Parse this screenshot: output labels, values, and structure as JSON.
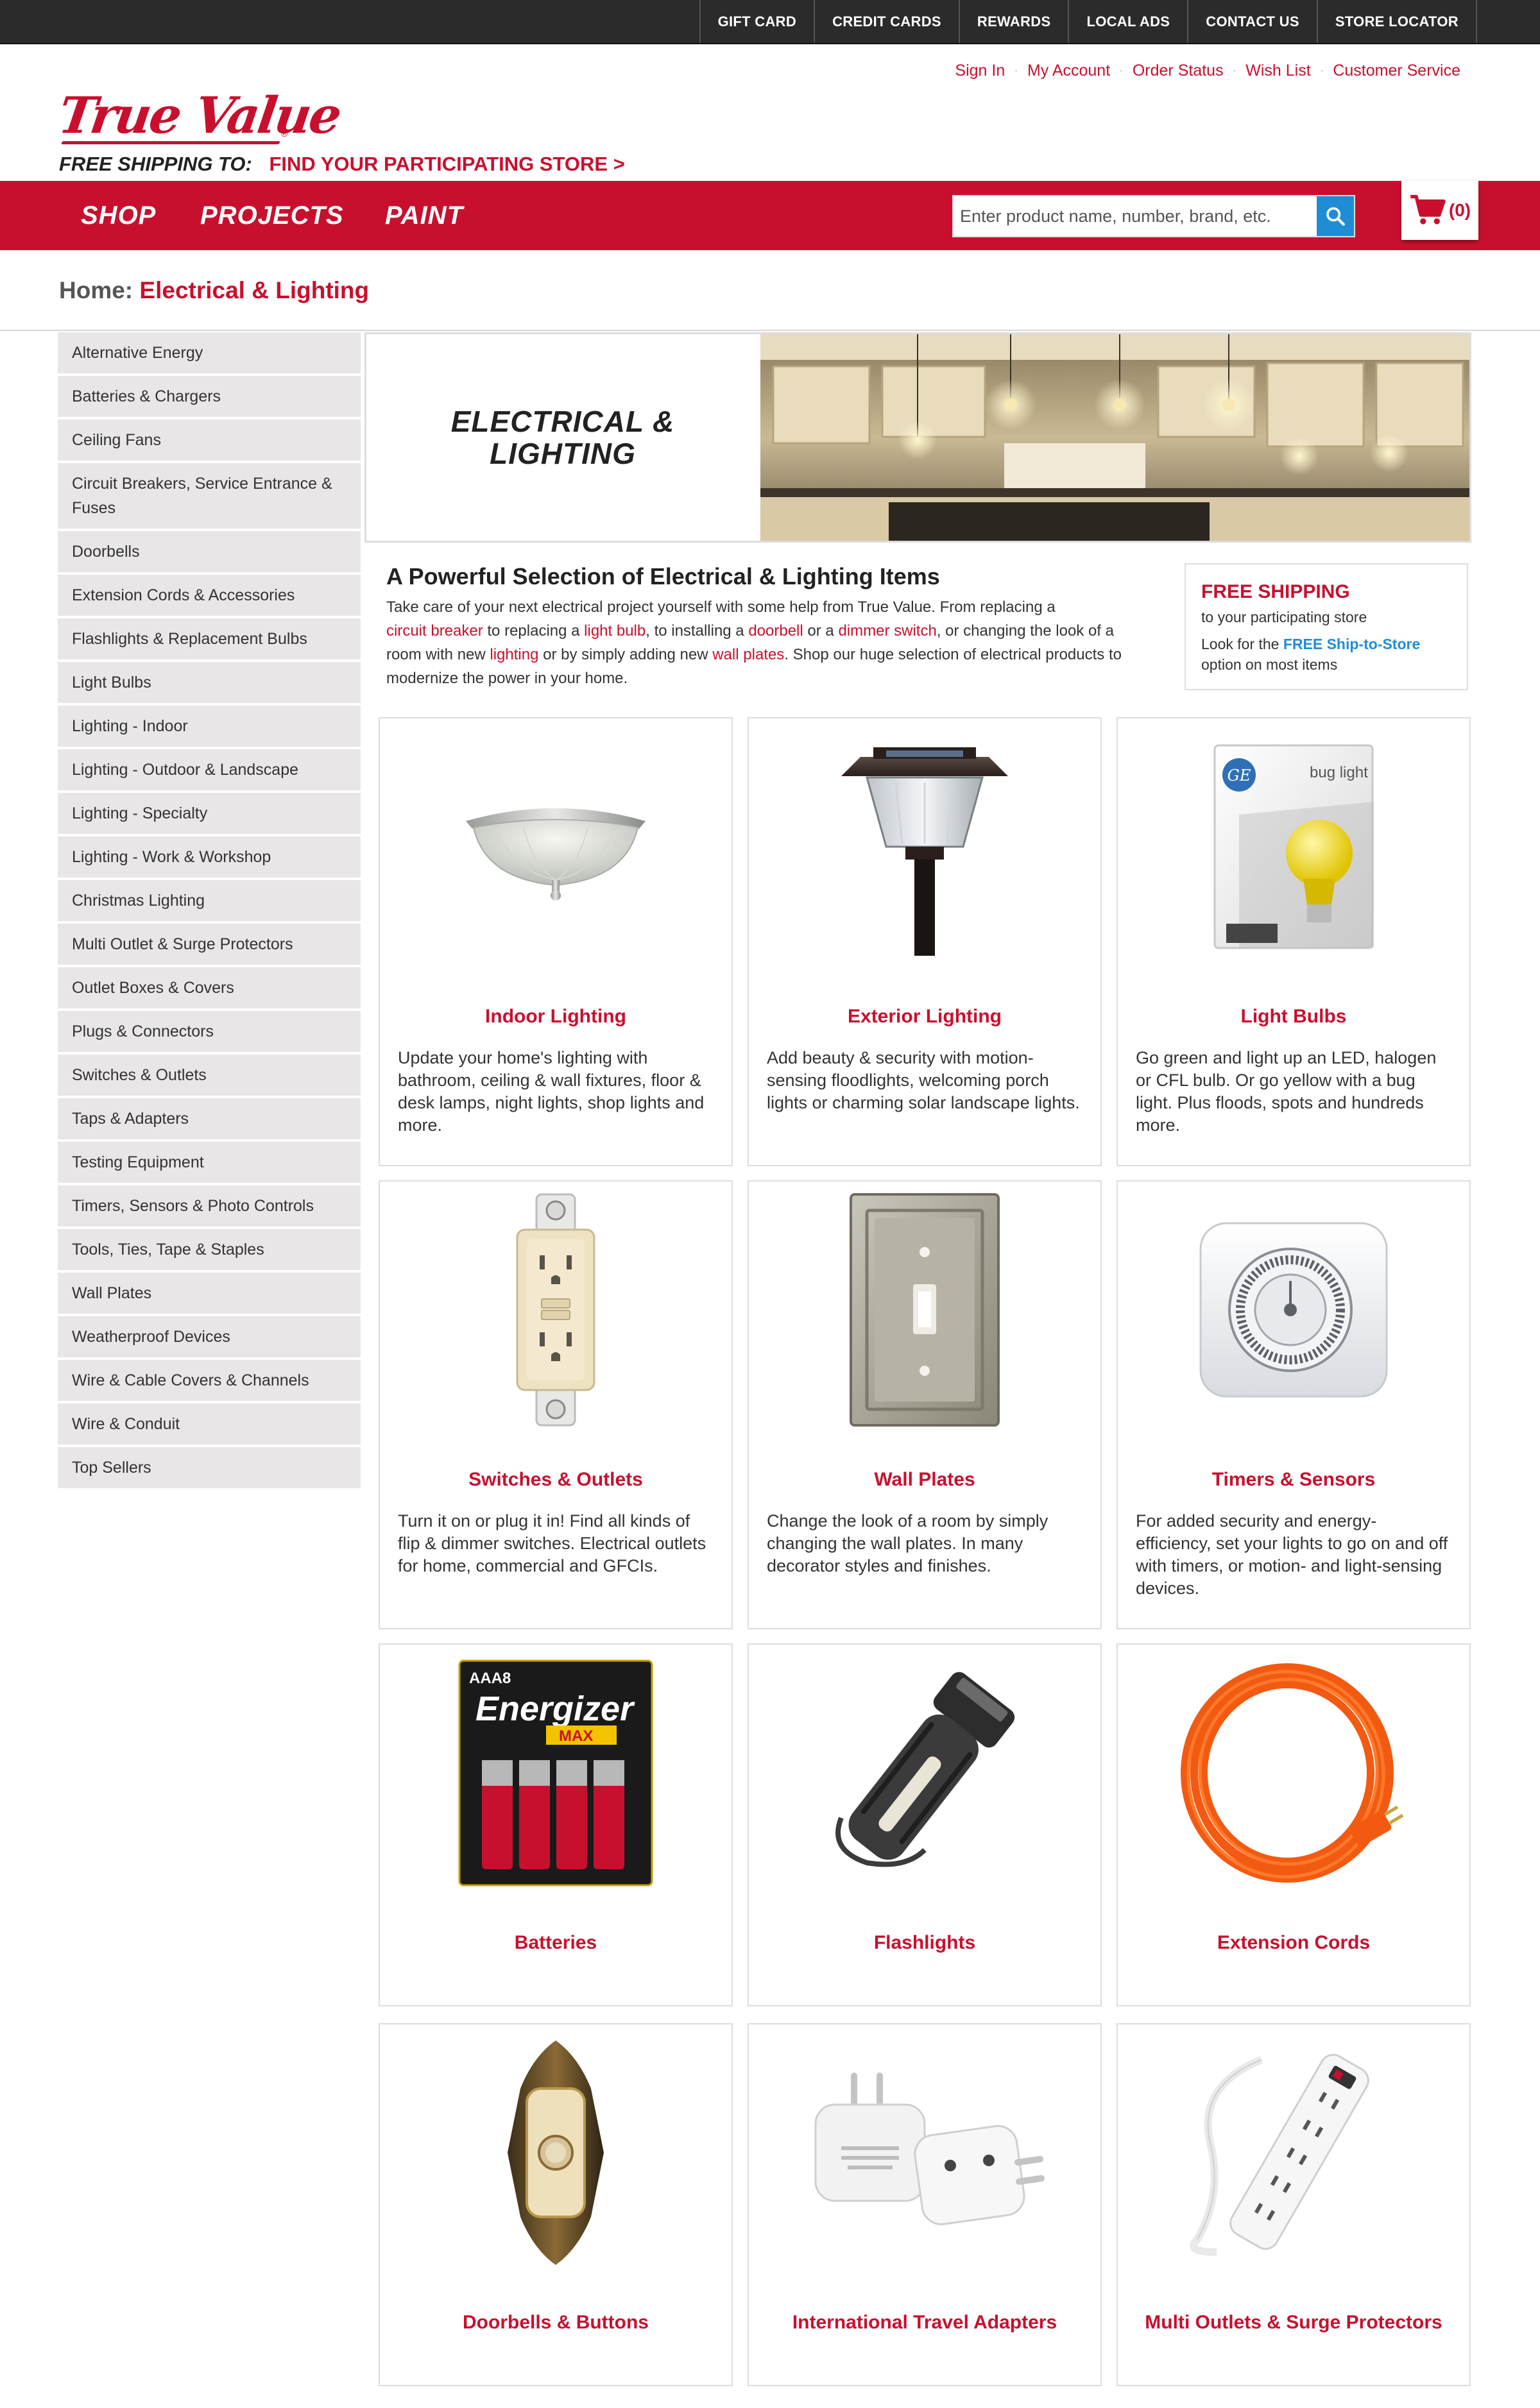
{
  "utility_nav": [
    "GIFT CARD",
    "CREDIT CARDS",
    "REWARDS",
    "LOCAL ADS",
    "CONTACT US",
    "STORE LOCATOR"
  ],
  "account_links": [
    "Sign In",
    "My Account",
    "Order Status",
    "Wish List",
    "Customer Service"
  ],
  "logo": {
    "text": "True Value"
  },
  "shipping": {
    "label": "FREE SHIPPING TO:",
    "link": "FIND YOUR PARTICIPATING STORE >"
  },
  "main_nav": [
    "SHOP",
    "PROJECTS",
    "PAINT"
  ],
  "search": {
    "placeholder": "Enter product name, number, brand, etc."
  },
  "cart": {
    "count": "(0)"
  },
  "breadcrumb": {
    "home": "Home:",
    "current": "Electrical & Lighting"
  },
  "sidebar": [
    "Alternative Energy",
    "Batteries & Chargers",
    "Ceiling Fans",
    "Circuit Breakers, Service Entrance & Fuses",
    "Doorbells",
    "Extension Cords & Accessories",
    "Flashlights & Replacement Bulbs",
    "Light Bulbs",
    "Lighting - Indoor",
    "Lighting - Outdoor & Landscape",
    "Lighting - Specialty",
    "Lighting - Work & Workshop",
    "Christmas Lighting",
    "Multi Outlet & Surge Protectors",
    "Outlet Boxes & Covers",
    "Plugs & Connectors",
    "Switches & Outlets",
    "Taps & Adapters",
    "Testing Equipment",
    "Timers, Sensors & Photo Controls",
    "Tools, Ties, Tape & Staples",
    "Wall Plates",
    "Weatherproof Devices",
    "Wire & Cable Covers & Channels",
    "Wire & Conduit",
    "Top Sellers"
  ],
  "hero": {
    "line1": "ELECTRICAL &",
    "line2": "LIGHTING"
  },
  "intro": {
    "heading": "A Powerful Selection of Electrical & Lighting Items",
    "t1": "Take care of your next electrical project yourself with some help from True Value. From replacing a",
    "l1": "circuit breaker",
    "t2": " to replacing a ",
    "l2": "light bulb",
    "t3": ", to installing a ",
    "l3": "doorbell",
    "t4": " or a ",
    "l4": "dimmer switch",
    "t5": ", or changing the look of a room with new ",
    "l5": "lighting",
    "t6": " or by simply adding new ",
    "l6": "wall plates",
    "t7": ". Shop our huge selection of electrical products to modernize the power in your home."
  },
  "ship_box": {
    "title": "FREE SHIPPING",
    "sub": "to your participating store",
    "note_pre": "Look for the ",
    "note_link": "FREE Ship-to-Store",
    "note_post": " option on most items"
  },
  "categories": [
    {
      "title": "Indoor Lighting",
      "desc": "Update your home's lighting with bathroom, ceiling & wall fixtures, floor & desk lamps, night lights, shop lights and more.",
      "icon": "ceiling-light-icon"
    },
    {
      "title": "Exterior Lighting",
      "desc": "Add beauty & security with motion-sensing floodlights, welcoming porch lights or charming solar landscape lights.",
      "icon": "solar-lamp-icon"
    },
    {
      "title": "Light Bulbs",
      "desc": "Go green and light up an LED, halogen or CFL bulb. Or go yellow with a bug light. Plus floods, spots and hundreds more.",
      "icon": "bug-light-icon",
      "package_text": "bug light",
      "package_brand": "GE"
    },
    {
      "title": "Switches & Outlets",
      "desc": "Turn it on or plug it in! Find all kinds of flip & dimmer switches. Electrical outlets for home, commercial and GFCIs.",
      "icon": "gfci-outlet-icon"
    },
    {
      "title": "Wall Plates",
      "desc": "Change the look of a room by simply changing the wall plates. In many decorator styles and finishes.",
      "icon": "wall-plate-icon"
    },
    {
      "title": "Timers & Sensors",
      "desc": "For added security and energy-efficiency, set your lights to go on and off with timers, or motion- and light-sensing devices.",
      "icon": "timer-icon"
    },
    {
      "title": "Batteries",
      "desc": "",
      "icon": "battery-pack-icon",
      "package_text": "Energizer",
      "package_sub": "MAX",
      "package_count": "AAA8"
    },
    {
      "title": "Flashlights",
      "desc": "",
      "icon": "flashlight-icon"
    },
    {
      "title": "Extension Cords",
      "desc": "",
      "icon": "extension-cord-icon"
    },
    {
      "title": "Doorbells & Buttons",
      "desc": "",
      "icon": "doorbell-button-icon"
    },
    {
      "title": "International Travel Adapters",
      "desc": "",
      "icon": "travel-adapter-icon"
    },
    {
      "title": "Multi Outlets & Surge Protectors",
      "desc": "",
      "icon": "power-strip-icon"
    }
  ],
  "colors": {
    "brand_red": "#c8102e",
    "utility_bar": "#2b2b2b",
    "link_blue": "#1f8dd6",
    "sidebar_bg": "#e8e6e6"
  }
}
